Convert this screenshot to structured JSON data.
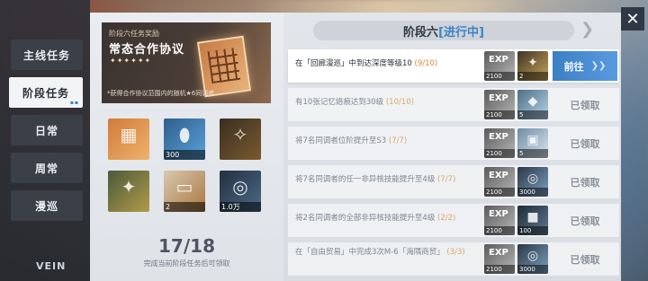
{
  "sidebar": {
    "tabs": [
      {
        "label": "主线任务",
        "active": false
      },
      {
        "label": "阶段任务",
        "active": true
      },
      {
        "label": "日常",
        "active": false
      },
      {
        "label": "周常",
        "active": false
      },
      {
        "label": "漫巡",
        "active": false
      }
    ],
    "logo": "VEIN"
  },
  "banner": {
    "subtitle": "阶段六任务奖励",
    "title": "常态合作协议",
    "stars": "✦✦✦✦✦✦",
    "note": "*获得合作协议范围内的随机★6同调者"
  },
  "rewards_preview": [
    {
      "icon": "grid-card-icon",
      "count": ""
    },
    {
      "icon": "bottle-icon",
      "count": "300"
    },
    {
      "icon": "star-card-icon",
      "count": ""
    },
    {
      "icon": "star-card-green-icon",
      "count": ""
    },
    {
      "icon": "ticket-icon",
      "count": "2"
    },
    {
      "icon": "coin-icon",
      "count": "1.0万"
    }
  ],
  "progress": {
    "current": "17",
    "total": "/18",
    "hint": "完成当前阶段任务后可领取"
  },
  "stage": {
    "name": "阶段六",
    "state": "[进行中]"
  },
  "tasks": [
    {
      "text": "在「回廊漫巡」中到达深度等级10",
      "progress": "(9/10)",
      "r1_count": "2100",
      "r2_type": "gold",
      "r2_count": "2",
      "status": "go",
      "action": "前往"
    },
    {
      "text": "有10张记忆烙痕达到30级",
      "progress": "(10/10)",
      "r1_count": "2100",
      "r2_type": "crystal",
      "r2_count": "5",
      "status": "claimed",
      "action": "已领取"
    },
    {
      "text": "将7名同调者位阶提升至S3",
      "progress": "(7/7)",
      "r1_count": "2100",
      "r2_type": "box",
      "r2_count": "5",
      "status": "claimed",
      "action": "已领取"
    },
    {
      "text": "将7名同调者的任一非异核技能提升至4级",
      "progress": "(7/7)",
      "r1_count": "2100",
      "r2_type": "coin",
      "r2_count": "3000",
      "status": "claimed",
      "action": "已领取"
    },
    {
      "text": "将2名同调者的全部非异核技能提升至4级",
      "progress": "(2/2)",
      "r1_count": "2100",
      "r2_type": "chest",
      "r2_count": "100",
      "status": "claimed",
      "action": "已领取"
    },
    {
      "text": "在「自由贸易」中完成3次M-6「海隅商贸」",
      "progress": "(3/3)",
      "r1_count": "2100",
      "r2_type": "coin",
      "r2_count": "3000",
      "status": "claimed",
      "action": "已领取"
    }
  ],
  "close_label": "✕",
  "colors": {
    "accent": "#3b82c7",
    "progress_orange": "#d48a2e"
  }
}
